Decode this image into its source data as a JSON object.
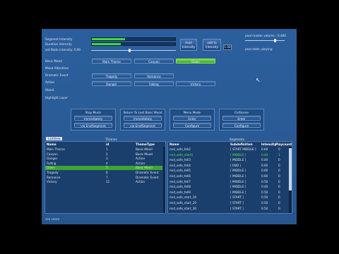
{
  "labels": {
    "segment_intensity": "Segment Intensity",
    "duration_intensity": "Duration Intensity",
    "set_state_intensity": "set State intensity: 0.90",
    "hold_intensity": "Hold Intensity",
    "add_to_intensity": "add to Intensity",
    "add_value": "1.00",
    "master_volume": "pool master volume : 0.480",
    "pool_status": "pool stats: playing",
    "basic_mood": "Basic Mood",
    "mood_alteration": "Mood Alteration",
    "dramatic_event": "Dramatic Event",
    "action": "Action",
    "stand": "Stand",
    "highlight_layer": "Highlight Layer",
    "footer": "see some"
  },
  "levels": {
    "segment_intensity": 0.4,
    "duration_intensity": 0.35,
    "set_state_slider": 0.45,
    "master_volume_slider": 0.75
  },
  "theme_buttons": {
    "main_theme": "Main Theme",
    "canyon": "Canyon",
    "dawn": "Dawn",
    "tragedy": "Tragedy",
    "romance": "Romance",
    "danger": "Danger",
    "falling": "Falling",
    "victory": "Victory"
  },
  "control_groups": [
    {
      "title": "Stop Music",
      "buttons": [
        "Immediately",
        "via End/Segment"
      ]
    },
    {
      "title": "Return To Last Basic Mood",
      "buttons": [
        "Immediately",
        "via End/Segment"
      ]
    },
    {
      "title": "Menu Mode",
      "buttons": [
        "Enter",
        "Configure"
      ]
    },
    {
      "title": "CutScene",
      "buttons": [
        "Enter",
        "Configure"
      ]
    }
  ],
  "tabs": {
    "listview": "ListView",
    "themes": "Themes",
    "segments": "Segments"
  },
  "themes_table": {
    "headers": [
      "Name",
      "id",
      "ThemeType"
    ],
    "rows": [
      [
        "Main Theme",
        "1",
        "Basic Mood"
      ],
      [
        "Canyon",
        "2",
        "Basic Mood"
      ],
      [
        "Danger",
        "3",
        "Action"
      ],
      [
        "Falling",
        "4",
        "Action"
      ],
      [
        "Dawn",
        "5",
        "Basic Mood"
      ],
      [
        "Tragedy",
        "6",
        "Dramatic Event"
      ],
      [
        "Romance",
        "7",
        "Dramatic Event"
      ],
      [
        "Victory",
        "11",
        "Action"
      ]
    ]
  },
  "segments_table": {
    "headers": [
      "Name",
      "Subdefinition",
      "Intensity",
      "Playcount"
    ],
    "rows": [
      [
        "mid_safe_fell2",
        "[ START MIDDLE ]",
        "0.60",
        "0"
      ],
      [
        "mid_safe_start1",
        "[ MIDDLE ]",
        "0.40",
        "1"
      ],
      [
        "mid_safe_fell3",
        "[ MIDDLE ]",
        "0.40",
        "0"
      ],
      [
        "mid_safe_fell4",
        "[ END ]",
        "0.60",
        "0"
      ],
      [
        "mid_safe_fell5",
        "[ MIDDLE ]",
        "0.60",
        "0"
      ],
      [
        "mid_safe_fell6",
        "[ MIDDLE ]",
        "0.60",
        "0"
      ],
      [
        "mid_safe_fell7",
        "[ MIDDLE ]",
        "0.50",
        "0"
      ],
      [
        "mid_safe_fell8",
        "[ MIDDLE ]",
        "0.40",
        "0"
      ],
      [
        "mid_safe_fell9",
        "[ MIDDLE ]",
        "0.50",
        "0"
      ],
      [
        "mid_safe_start_10",
        "[ START ]",
        "0.50",
        "0"
      ],
      [
        "mid_safe_start_20",
        "[ START ]",
        "0.50",
        "0"
      ],
      [
        "mid_safe_start_30",
        "[ START ]",
        "0.50",
        "0"
      ]
    ]
  },
  "colors": {
    "window": "#2a5c97",
    "active_green": "#4fd336"
  }
}
